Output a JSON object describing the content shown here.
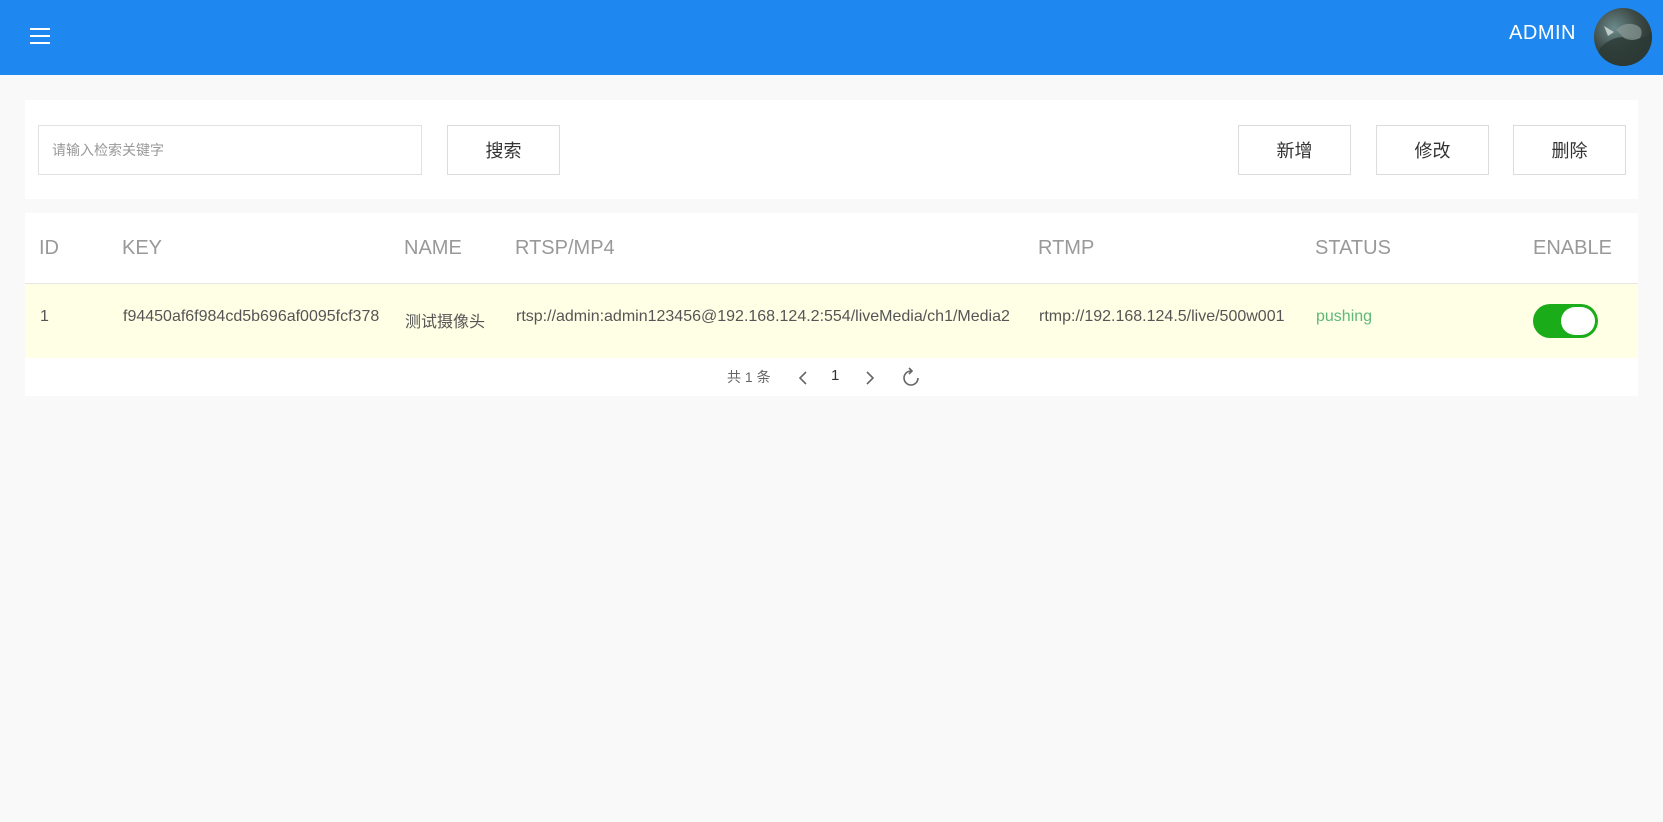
{
  "header": {
    "username": "ADMIN",
    "bg_color": "#1e88f0",
    "menu_icon": "hamburger-menu-icon",
    "avatar_icon": "avatar"
  },
  "toolbar": {
    "search_placeholder": "请输入检索关键字",
    "search_value": "",
    "search_label": "搜索",
    "add_label": "新增",
    "edit_label": "修改",
    "delete_label": "删除"
  },
  "table": {
    "columns": [
      "ID",
      "KEY",
      "NAME",
      "RTSP/MP4",
      "RTMP",
      "STATUS",
      "ENABLE"
    ],
    "rows": [
      {
        "id": "1",
        "key": "f94450af6f984cd5b696af0095fcf378",
        "name": "测试摄像头",
        "rtsp": "rtsp://admin:admin123456@192.168.124.2:554/liveMedia/ch1/Media2",
        "rtmp": "rtmp://192.168.124.5/live/500w001",
        "status": "pushing",
        "enable": true
      }
    ],
    "row_highlight_color": "#ffffe6",
    "status_color": "#5fb878",
    "switch_on_color": "#1aad19"
  },
  "pager": {
    "total_text": "共 1 条",
    "current_page": "1",
    "prev_icon": "chevron-left-icon",
    "next_icon": "chevron-right-icon",
    "refresh_icon": "refresh-icon"
  }
}
